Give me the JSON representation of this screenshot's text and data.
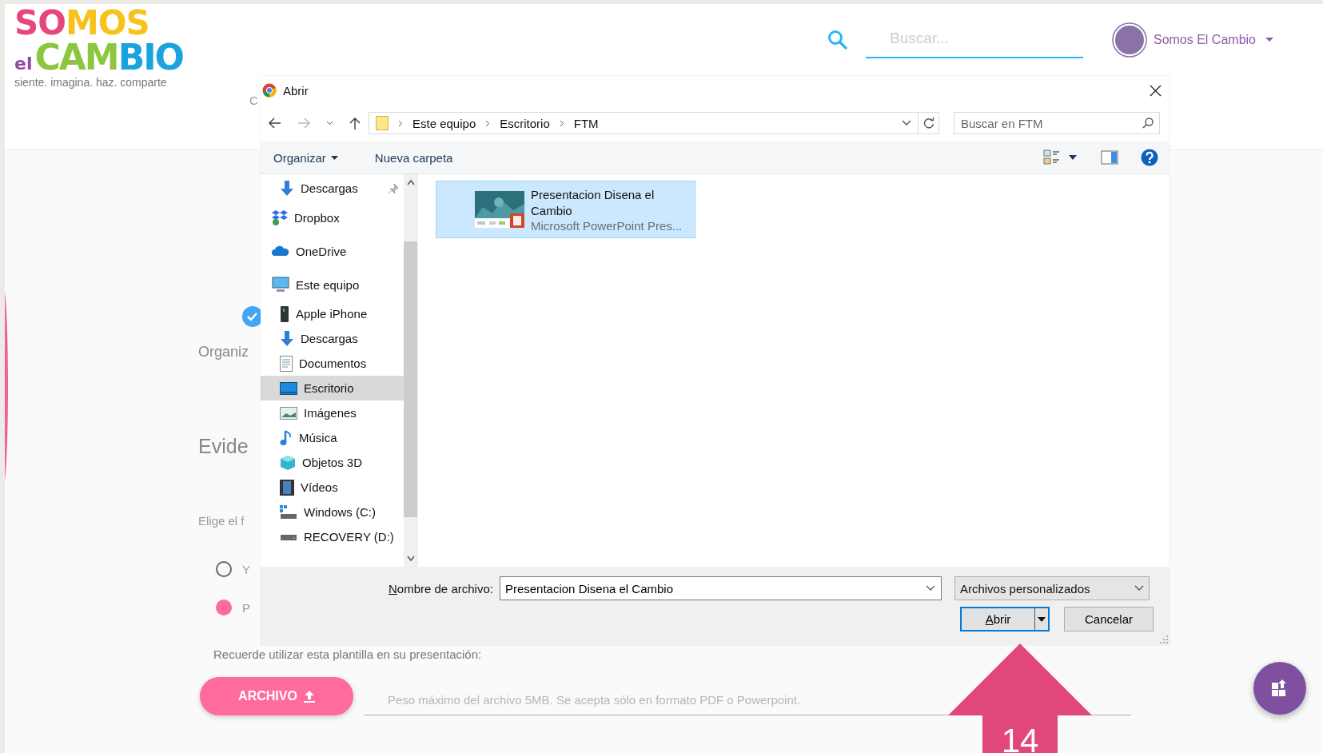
{
  "header": {
    "logo": {
      "top": "SOMOS",
      "small": "el",
      "bottom": "CAMBIO",
      "tagline": "siente. imagina. haz. comparte"
    },
    "search": {
      "placeholder": "Buscar..."
    },
    "user": {
      "name": "Somos El Cambio"
    }
  },
  "page": {
    "tab_fragment": "C",
    "heading_fragment": "Organiz",
    "section_fragment": "Evide",
    "hint_fragment": "Elige el f",
    "options": [
      {
        "label": "Y",
        "selected": false
      },
      {
        "label": "P",
        "selected": true
      }
    ],
    "notice": "Recuerde utilizar esta plantilla en su presentación:",
    "upload_button": "ARCHIVO",
    "file_field": {
      "placeholder": "Peso máximo del archivo 5MB. Se acepta sólo en formato PDF o Powerpoint."
    }
  },
  "dialog": {
    "title": "Abrir",
    "path": [
      "Este equipo",
      "Escritorio",
      "FTM"
    ],
    "search": {
      "placeholder": "Buscar en FTM"
    },
    "toolbar": [
      "Organizar",
      "Nueva carpeta"
    ],
    "nav": [
      {
        "children": [
          {
            "label": "Descargas",
            "kind": "downloads",
            "pinned": true,
            "selected": false
          }
        ]
      },
      {
        "label": "Dropbox",
        "kind": "dropbox",
        "pinned": false,
        "selected": false
      },
      {
        "label": "OneDrive",
        "kind": "onedrive",
        "pinned": false,
        "selected": false
      },
      {
        "label": "Este equipo",
        "kind": "pc",
        "pinned": false,
        "selected": false,
        "children": [
          {
            "label": "Apple iPhone",
            "kind": "phone",
            "pinned": false,
            "selected": false
          },
          {
            "label": "Descargas",
            "kind": "downloads",
            "pinned": false,
            "selected": false
          },
          {
            "label": "Documentos",
            "kind": "documents",
            "pinned": false,
            "selected": false
          },
          {
            "label": "Escritorio",
            "kind": "desktop",
            "pinned": false,
            "selected": true
          },
          {
            "label": "Imágenes",
            "kind": "pictures",
            "pinned": false,
            "selected": false
          },
          {
            "label": "Música",
            "kind": "music",
            "pinned": false,
            "selected": false
          },
          {
            "label": "Objetos 3D",
            "kind": "objects3d",
            "pinned": false,
            "selected": false
          },
          {
            "label": "Vídeos",
            "kind": "videos",
            "pinned": false,
            "selected": false
          },
          {
            "label": "Windows (C:)",
            "kind": "drive_windows",
            "pinned": false,
            "selected": false
          },
          {
            "label": "RECOVERY (D:)",
            "kind": "drive",
            "pinned": false,
            "selected": false
          }
        ]
      }
    ],
    "files": [
      {
        "name": "Presentacion Disena el Cambio",
        "type": "Microsoft PowerPoint Pres...",
        "selected": true
      }
    ],
    "filename_label": "Nombre de archivo:",
    "filename": "Presentacion Disena el Cambio",
    "filetype": "Archivos personalizados",
    "buttons": [
      {
        "label": "Abrir",
        "kind": "split",
        "default": true
      },
      {
        "label": "Cancelar",
        "kind": "plain",
        "default": false
      }
    ]
  },
  "annotation": {
    "step": "14"
  }
}
